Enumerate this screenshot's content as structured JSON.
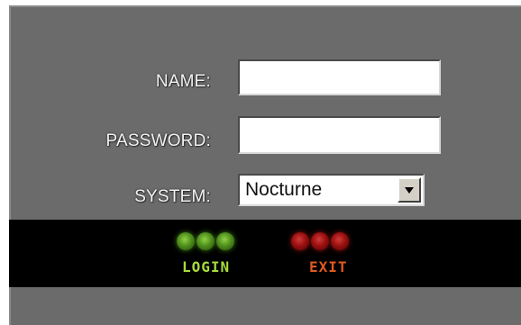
{
  "form": {
    "name_label": "NAME:",
    "name_value": "",
    "password_label": "PASSWORD:",
    "password_value": "",
    "system_label": "SYSTEM:",
    "system_value": "Nocturne"
  },
  "actions": {
    "login_label": "LOGIN",
    "exit_label": "EXIT"
  },
  "colors": {
    "panel": "#6b6b6b",
    "bar": "#000000",
    "login": "#a6dc3c",
    "exit": "#e05a20"
  }
}
